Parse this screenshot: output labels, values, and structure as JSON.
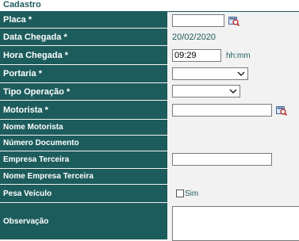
{
  "section_title": "Cadastro",
  "fields": {
    "placa": {
      "label": "Placa *",
      "value": ""
    },
    "data_chegada": {
      "label": "Data Chegada *",
      "value": "20/02/2020"
    },
    "hora_chegada": {
      "label": "Hora Chegada *",
      "value": "09:29",
      "hint": "hh:mm"
    },
    "portaria": {
      "label": "Portaria *",
      "value": ""
    },
    "tipo_operacao": {
      "label": "Tipo Operação *",
      "value": ""
    },
    "motorista": {
      "label": "Motorista *",
      "value": ""
    },
    "nome_motorista": {
      "label": "Nome Motorista",
      "value": ""
    },
    "numero_documento": {
      "label": "Número Documento",
      "value": ""
    },
    "empresa_terceira": {
      "label": "Empresa Terceira",
      "value": ""
    },
    "nome_empresa_terceira": {
      "label": "Nome Empresa Terceira",
      "value": ""
    },
    "pesa_veiculo": {
      "label": "Pesa Veículo",
      "checkbox_label": "Sim",
      "checked": false
    },
    "observacao": {
      "label": "Observação",
      "value": ""
    }
  },
  "colors": {
    "label_bg": "#1d5c5c",
    "label_text": "#ffffff",
    "value_bg": "#f2f2f2",
    "accent_text": "#1d5c5c"
  },
  "icons": {
    "lookup": "search-lookup-icon",
    "dropdown": "chevron-down-icon"
  }
}
